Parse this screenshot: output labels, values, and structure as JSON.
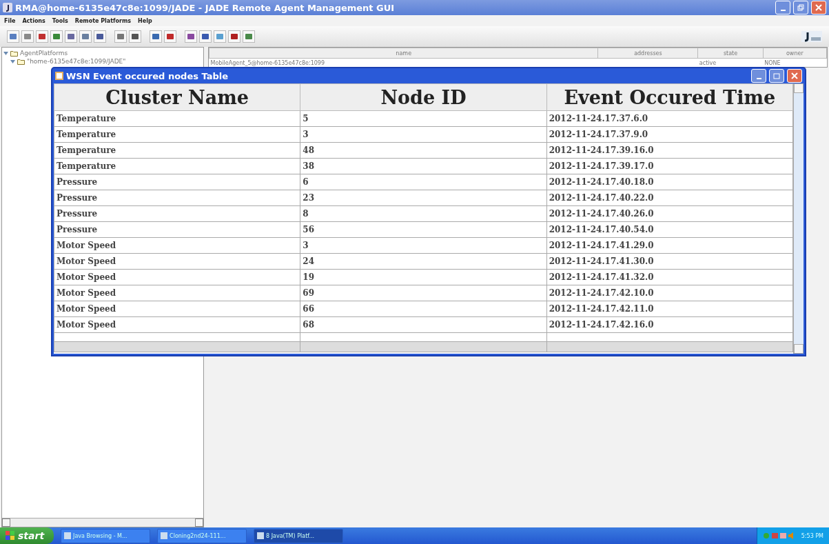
{
  "window": {
    "title": "RMA@home-6135e47c8e:1099/JADE - JADE Remote Agent Management GUI"
  },
  "menu": [
    "File",
    "Actions",
    "Tools",
    "Remote Platforms",
    "Help"
  ],
  "tree": [
    {
      "label": "AgentPlatforms",
      "expanded": true,
      "children": [
        {
          "label": "\"home-6135e47c8e:1099/JADE\"",
          "expanded": true
        }
      ]
    }
  ],
  "agent_table": {
    "columns": [
      "name",
      "addresses",
      "state",
      "owner"
    ],
    "rows": [
      [
        "MobileAgent_5@home-6135e47c8e:1099",
        "",
        "active",
        "NONE"
      ]
    ]
  },
  "dialog": {
    "title": "WSN Event occured nodes Table",
    "columns": [
      "Cluster Name",
      "Node ID",
      "Event Occured Time"
    ],
    "rows": [
      [
        "Temperature",
        "5",
        "2012-11-24.17.37.6.0"
      ],
      [
        "Temperature",
        "3",
        "2012-11-24.17.37.9.0"
      ],
      [
        "Temperature",
        "48",
        "2012-11-24.17.39.16.0"
      ],
      [
        "Temperature",
        "38",
        "2012-11-24.17.39.17.0"
      ],
      [
        "Pressure",
        "6",
        "2012-11-24.17.40.18.0"
      ],
      [
        "Pressure",
        "23",
        "2012-11-24.17.40.22.0"
      ],
      [
        "Pressure",
        "8",
        "2012-11-24.17.40.26.0"
      ],
      [
        "Pressure",
        "56",
        "2012-11-24.17.40.54.0"
      ],
      [
        "Motor Speed",
        "3",
        "2012-11-24.17.41.29.0"
      ],
      [
        "Motor Speed",
        "24",
        "2012-11-24.17.41.30.0"
      ],
      [
        "Motor Speed",
        "19",
        "2012-11-24.17.41.32.0"
      ],
      [
        "Motor Speed",
        "69",
        "2012-11-24.17.42.10.0"
      ],
      [
        "Motor Speed",
        "66",
        "2012-11-24.17.42.11.0"
      ],
      [
        "Motor Speed",
        "68",
        "2012-11-24.17.42.16.0"
      ]
    ]
  },
  "taskbar": {
    "start": "start",
    "tasks": [
      {
        "label": "Java Browsing - M...",
        "selected": false
      },
      {
        "label": "Cloning2nd24-111...",
        "selected": false
      },
      {
        "label": "8 Java(TM) Platf...",
        "selected": true
      }
    ],
    "clock": "5:53 PM"
  }
}
